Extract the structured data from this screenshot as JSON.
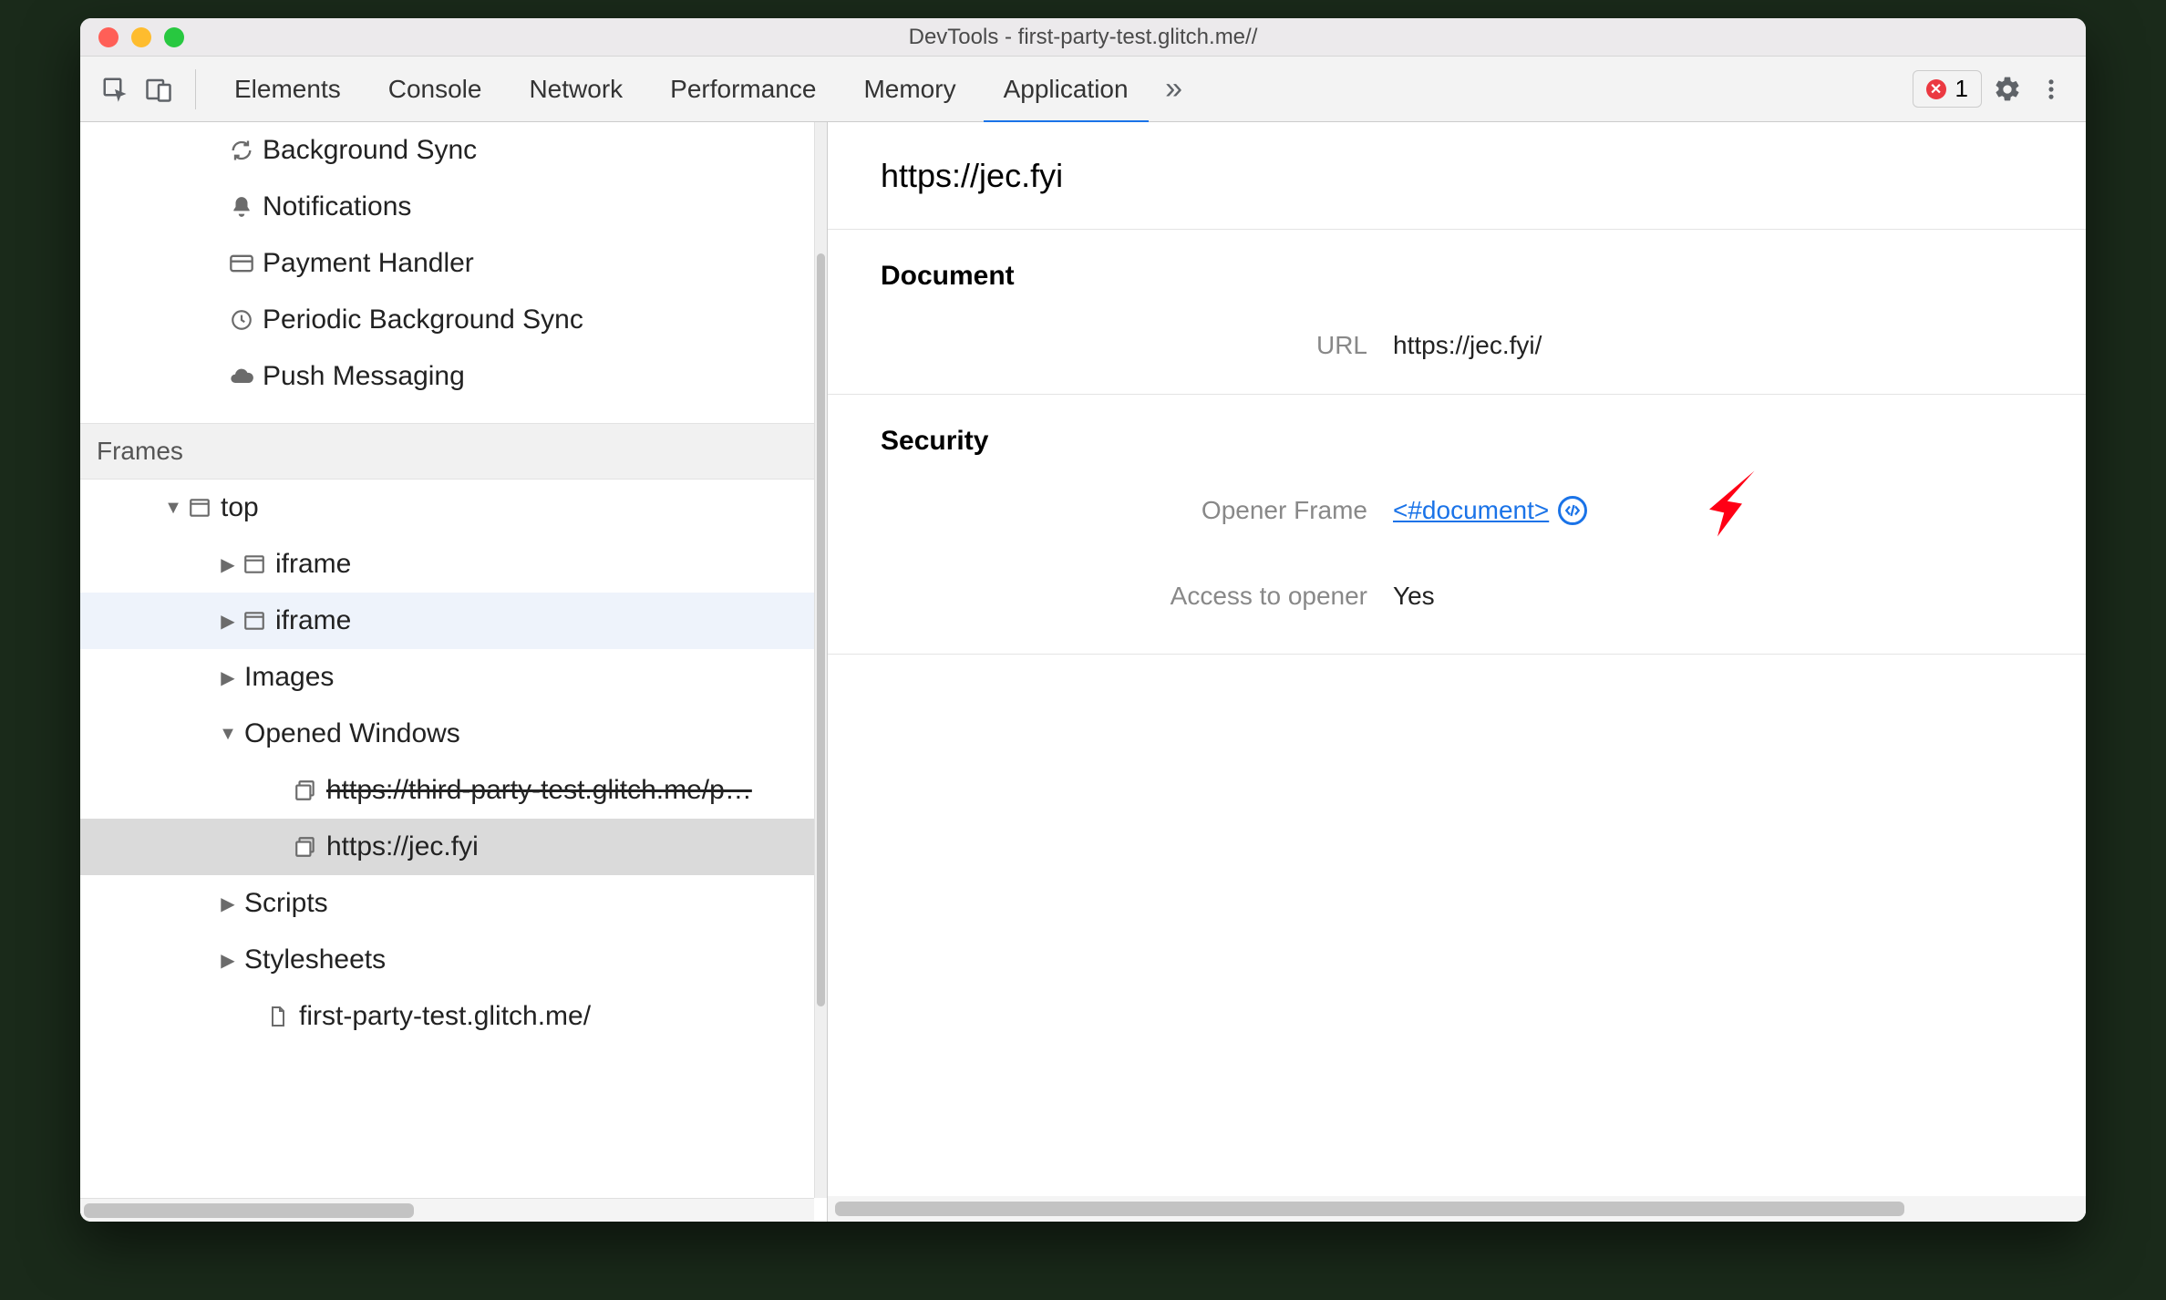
{
  "window": {
    "title": "DevTools - first-party-test.glitch.me//"
  },
  "toolbar": {
    "tabs": {
      "elements": "Elements",
      "console": "Console",
      "network": "Network",
      "performance": "Performance",
      "memory": "Memory",
      "application": "Application"
    },
    "error_count": "1"
  },
  "sidebar": {
    "bg_sync": "Background Sync",
    "notifications": "Notifications",
    "payment_handler": "Payment Handler",
    "periodic_bg_sync": "Periodic Background Sync",
    "push_messaging": "Push Messaging",
    "frames_header": "Frames",
    "top": "top",
    "iframe1": "iframe",
    "iframe2": "iframe",
    "images": "Images",
    "opened_windows": "Opened Windows",
    "ow1": "https://third-party-test.glitch.me/p…",
    "ow2": "https://jec.fyi",
    "scripts": "Scripts",
    "stylesheets": "Stylesheets",
    "doc": "first-party-test.glitch.me/"
  },
  "main": {
    "title": "https://jec.fyi",
    "document": {
      "heading": "Document",
      "url_label": "URL",
      "url_value": "https://jec.fyi/"
    },
    "security": {
      "heading": "Security",
      "opener_label": "Opener Frame",
      "opener_value": "<#document>",
      "access_label": "Access to opener",
      "access_value": "Yes"
    }
  }
}
